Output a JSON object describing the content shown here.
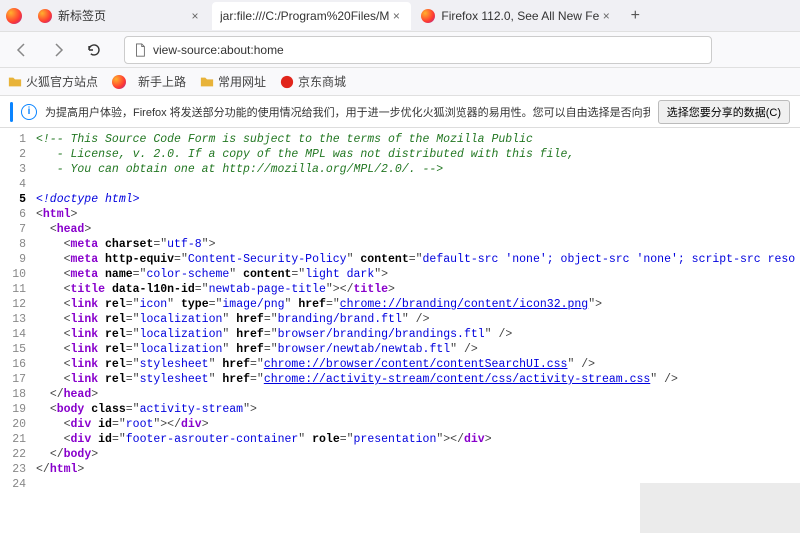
{
  "tabs": [
    {
      "label": "新标签页",
      "active": false,
      "favicon": "firefox"
    },
    {
      "label": "jar:file:///C:/Program%20Files/M",
      "active": true,
      "favicon": "none"
    },
    {
      "label": "Firefox 112.0, See All New Fe",
      "active": false,
      "favicon": "firefox"
    }
  ],
  "urlbar": {
    "text": "view-source:about:home"
  },
  "bookmarks": [
    {
      "label": "火狐官方站点",
      "icon": "folder"
    },
    {
      "label": "新手上路",
      "icon": "firefox"
    },
    {
      "label": "常用网址",
      "icon": "folder"
    },
    {
      "label": "京东商城",
      "icon": "jd"
    }
  ],
  "infobar": {
    "text": "为提高用户体验，Firefox 将发送部分功能的使用情况给我们，用于进一步优化火狐浏览器的易用性。您可以自由选择是否向我们分享数据。",
    "button": "选择您要分享的数据(C)"
  },
  "source_lines": [
    {
      "n": 1,
      "hl": false,
      "html": "<span class='c-comment'>&lt;!-- This Source Code Form is subject to the terms of the Mozilla Public</span>"
    },
    {
      "n": 2,
      "hl": false,
      "html": "<span class='c-comment'>&nbsp;&nbsp;&nbsp;- License, v. 2.0. If a copy of the MPL was not distributed with this file,</span>"
    },
    {
      "n": 3,
      "hl": false,
      "html": "<span class='c-comment'>&nbsp;&nbsp;&nbsp;- You can obtain one at http://mozilla.org/MPL/2.0/. --&gt;</span>"
    },
    {
      "n": 4,
      "hl": false,
      "html": ""
    },
    {
      "n": 5,
      "hl": true,
      "html": "<span class='c-doctype'>&lt;!doctype html&gt;</span>"
    },
    {
      "n": 6,
      "hl": false,
      "html": "<span class='c-punct'>&lt;</span><span class='c-tag'>html</span><span class='c-punct'>&gt;</span>"
    },
    {
      "n": 7,
      "hl": false,
      "html": "&nbsp;&nbsp;<span class='c-punct'>&lt;</span><span class='c-tag'>head</span><span class='c-punct'>&gt;</span>"
    },
    {
      "n": 8,
      "hl": false,
      "html": "&nbsp;&nbsp;&nbsp;&nbsp;<span class='c-punct'>&lt;</span><span class='c-tag'>meta</span> <span class='c-attr'>charset</span><span class='c-punct'>=&quot;</span><span class='c-val'>utf-8</span><span class='c-punct'>&quot;&gt;</span>"
    },
    {
      "n": 9,
      "hl": false,
      "html": "&nbsp;&nbsp;&nbsp;&nbsp;<span class='c-punct'>&lt;</span><span class='c-tag'>meta</span> <span class='c-attr'>http-equiv</span><span class='c-punct'>=&quot;</span><span class='c-val'>Content-Security-Policy</span><span class='c-punct'>&quot;</span> <span class='c-attr'>content</span><span class='c-punct'>=&quot;</span><span class='c-val'>default-src 'none'; object-src 'none'; script-src reso</span>"
    },
    {
      "n": 10,
      "hl": false,
      "html": "&nbsp;&nbsp;&nbsp;&nbsp;<span class='c-punct'>&lt;</span><span class='c-tag'>meta</span> <span class='c-attr'>name</span><span class='c-punct'>=&quot;</span><span class='c-val'>color-scheme</span><span class='c-punct'>&quot;</span> <span class='c-attr'>content</span><span class='c-punct'>=&quot;</span><span class='c-val'>light dark</span><span class='c-punct'>&quot;&gt;</span>"
    },
    {
      "n": 11,
      "hl": false,
      "html": "&nbsp;&nbsp;&nbsp;&nbsp;<span class='c-punct'>&lt;</span><span class='c-tag'>title</span> <span class='c-attr'>data-l10n-id</span><span class='c-punct'>=&quot;</span><span class='c-val'>newtab-page-title</span><span class='c-punct'>&quot;&gt;&lt;/</span><span class='c-tag'>title</span><span class='c-punct'>&gt;</span>"
    },
    {
      "n": 12,
      "hl": false,
      "html": "&nbsp;&nbsp;&nbsp;&nbsp;<span class='c-punct'>&lt;</span><span class='c-tag'>link</span> <span class='c-attr'>rel</span><span class='c-punct'>=&quot;</span><span class='c-val'>icon</span><span class='c-punct'>&quot;</span> <span class='c-attr'>type</span><span class='c-punct'>=&quot;</span><span class='c-val'>image/png</span><span class='c-punct'>&quot;</span> <span class='c-attr'>href</span><span class='c-punct'>=&quot;</span><span class='c-link'>chrome://branding/content/icon32.png</span><span class='c-punct'>&quot;&gt;</span>"
    },
    {
      "n": 13,
      "hl": false,
      "html": "&nbsp;&nbsp;&nbsp;&nbsp;<span class='c-punct'>&lt;</span><span class='c-tag'>link</span> <span class='c-attr'>rel</span><span class='c-punct'>=&quot;</span><span class='c-val'>localization</span><span class='c-punct'>&quot;</span> <span class='c-attr'>href</span><span class='c-punct'>=&quot;</span><span class='c-val'>branding/brand.ftl</span><span class='c-punct'>&quot; /&gt;</span>"
    },
    {
      "n": 14,
      "hl": false,
      "html": "&nbsp;&nbsp;&nbsp;&nbsp;<span class='c-punct'>&lt;</span><span class='c-tag'>link</span> <span class='c-attr'>rel</span><span class='c-punct'>=&quot;</span><span class='c-val'>localization</span><span class='c-punct'>&quot;</span> <span class='c-attr'>href</span><span class='c-punct'>=&quot;</span><span class='c-val'>browser/branding/brandings.ftl</span><span class='c-punct'>&quot; /&gt;</span>"
    },
    {
      "n": 15,
      "hl": false,
      "html": "&nbsp;&nbsp;&nbsp;&nbsp;<span class='c-punct'>&lt;</span><span class='c-tag'>link</span> <span class='c-attr'>rel</span><span class='c-punct'>=&quot;</span><span class='c-val'>localization</span><span class='c-punct'>&quot;</span> <span class='c-attr'>href</span><span class='c-punct'>=&quot;</span><span class='c-val'>browser/newtab/newtab.ftl</span><span class='c-punct'>&quot; /&gt;</span>"
    },
    {
      "n": 16,
      "hl": false,
      "html": "&nbsp;&nbsp;&nbsp;&nbsp;<span class='c-punct'>&lt;</span><span class='c-tag'>link</span> <span class='c-attr'>rel</span><span class='c-punct'>=&quot;</span><span class='c-val'>stylesheet</span><span class='c-punct'>&quot;</span> <span class='c-attr'>href</span><span class='c-punct'>=&quot;</span><span class='c-link'>chrome://browser/content/contentSearchUI.css</span><span class='c-punct'>&quot; /&gt;</span>"
    },
    {
      "n": 17,
      "hl": false,
      "html": "&nbsp;&nbsp;&nbsp;&nbsp;<span class='c-punct'>&lt;</span><span class='c-tag'>link</span> <span class='c-attr'>rel</span><span class='c-punct'>=&quot;</span><span class='c-val'>stylesheet</span><span class='c-punct'>&quot;</span> <span class='c-attr'>href</span><span class='c-punct'>=&quot;</span><span class='c-link'>chrome://activity-stream/content/css/activity-stream.css</span><span class='c-punct'>&quot; /&gt;</span>"
    },
    {
      "n": 18,
      "hl": false,
      "html": "&nbsp;&nbsp;<span class='c-punct'>&lt;/</span><span class='c-tag'>head</span><span class='c-punct'>&gt;</span>"
    },
    {
      "n": 19,
      "hl": false,
      "html": "&nbsp;&nbsp;<span class='c-punct'>&lt;</span><span class='c-tag'>body</span> <span class='c-attr'>class</span><span class='c-punct'>=&quot;</span><span class='c-val'>activity-stream</span><span class='c-punct'>&quot;&gt;</span>"
    },
    {
      "n": 20,
      "hl": false,
      "html": "&nbsp;&nbsp;&nbsp;&nbsp;<span class='c-punct'>&lt;</span><span class='c-tag'>div</span> <span class='c-attr'>id</span><span class='c-punct'>=&quot;</span><span class='c-val'>root</span><span class='c-punct'>&quot;&gt;&lt;/</span><span class='c-tag'>div</span><span class='c-punct'>&gt;</span>"
    },
    {
      "n": 21,
      "hl": false,
      "html": "&nbsp;&nbsp;&nbsp;&nbsp;<span class='c-punct'>&lt;</span><span class='c-tag'>div</span> <span class='c-attr'>id</span><span class='c-punct'>=&quot;</span><span class='c-val'>footer-asrouter-container</span><span class='c-punct'>&quot;</span> <span class='c-attr'>role</span><span class='c-punct'>=&quot;</span><span class='c-val'>presentation</span><span class='c-punct'>&quot;&gt;&lt;/</span><span class='c-tag'>div</span><span class='c-punct'>&gt;</span>"
    },
    {
      "n": 22,
      "hl": false,
      "html": "&nbsp;&nbsp;<span class='c-punct'>&lt;/</span><span class='c-tag'>body</span><span class='c-punct'>&gt;</span>"
    },
    {
      "n": 23,
      "hl": false,
      "html": "<span class='c-punct'>&lt;/</span><span class='c-tag'>html</span><span class='c-punct'>&gt;</span>"
    },
    {
      "n": 24,
      "hl": false,
      "html": ""
    }
  ]
}
